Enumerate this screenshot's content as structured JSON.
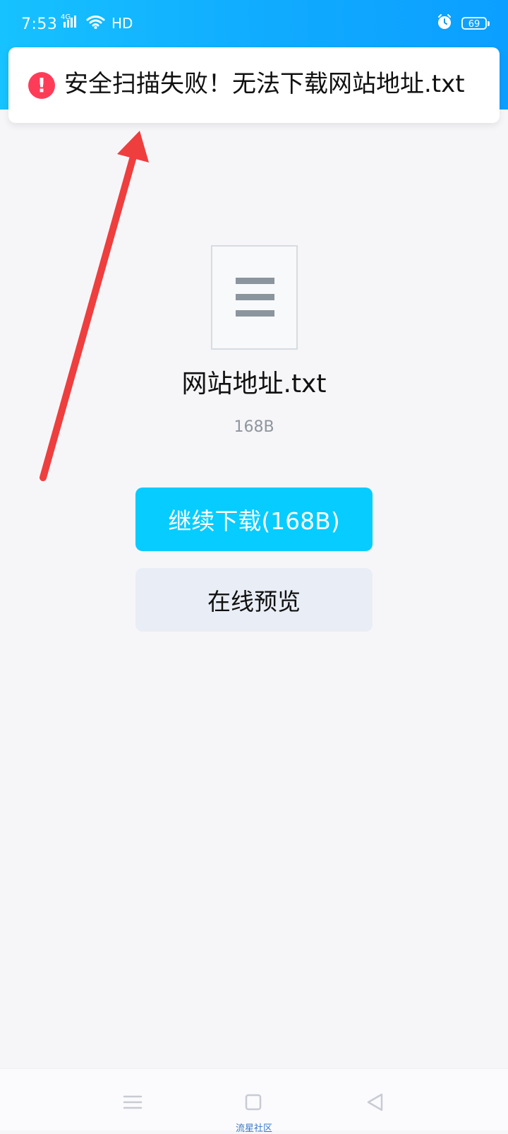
{
  "status_bar": {
    "time": "7:53",
    "network": "4G",
    "hd": "HD",
    "battery": "69"
  },
  "toast": {
    "icon": "error-icon",
    "message": "安全扫描失败！无法下载网站地址.txt"
  },
  "file": {
    "icon": "text-file-icon",
    "name": "网站地址.txt",
    "size": "168B"
  },
  "actions": {
    "continue_download": "继续下载(168B)",
    "online_preview": "在线预览"
  },
  "bottom_bar": {
    "menu_icon": "menu-icon",
    "home_icon": "home-icon",
    "back_icon": "back-icon",
    "label": "流星社区"
  },
  "colors": {
    "status_bar": "#10aaff",
    "error": "#ff3c58",
    "primary_button": "#07ccff",
    "secondary_button": "#e9edf5"
  }
}
